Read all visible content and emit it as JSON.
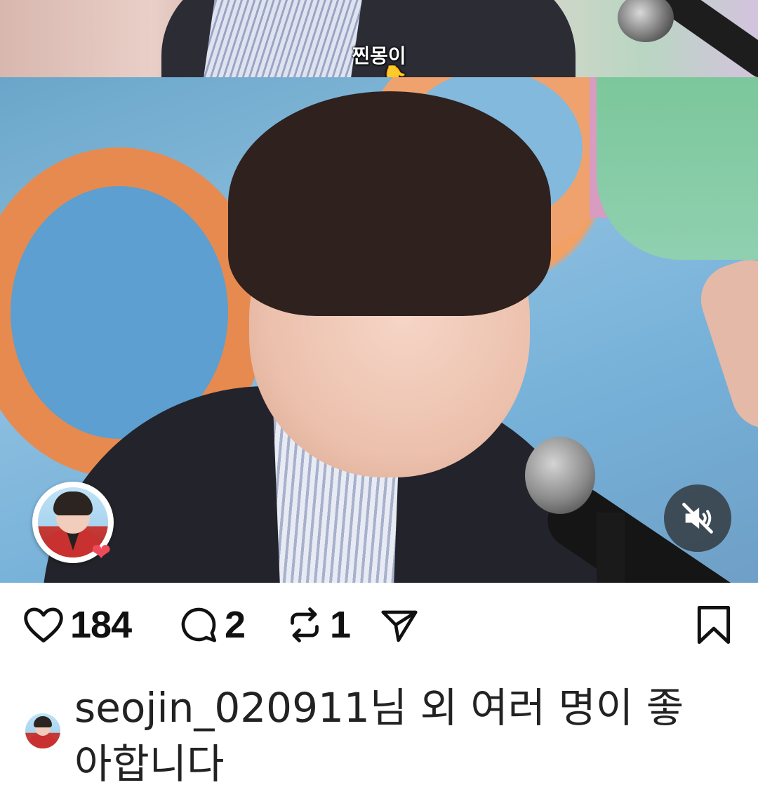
{
  "media": {
    "subtitle_text": "찐몽이",
    "pointer_glyph": "👇",
    "avatar_badge_icon": "heart-icon",
    "mute_icon": "speaker-muted-icon"
  },
  "actions": {
    "like": {
      "icon": "heart-outline-icon",
      "count": "184"
    },
    "comment": {
      "icon": "comment-bubble-icon",
      "count": "2"
    },
    "repost": {
      "icon": "repost-arrows-icon",
      "count": "1"
    },
    "share": {
      "icon": "paper-plane-icon"
    },
    "bookmark": {
      "icon": "bookmark-outline-icon"
    }
  },
  "likes_summary": {
    "text": "seojin_020911님 외 여러 명이 좋아합니다"
  },
  "colors": {
    "heart_badge": "#ef4a5a",
    "text": "#111111"
  }
}
